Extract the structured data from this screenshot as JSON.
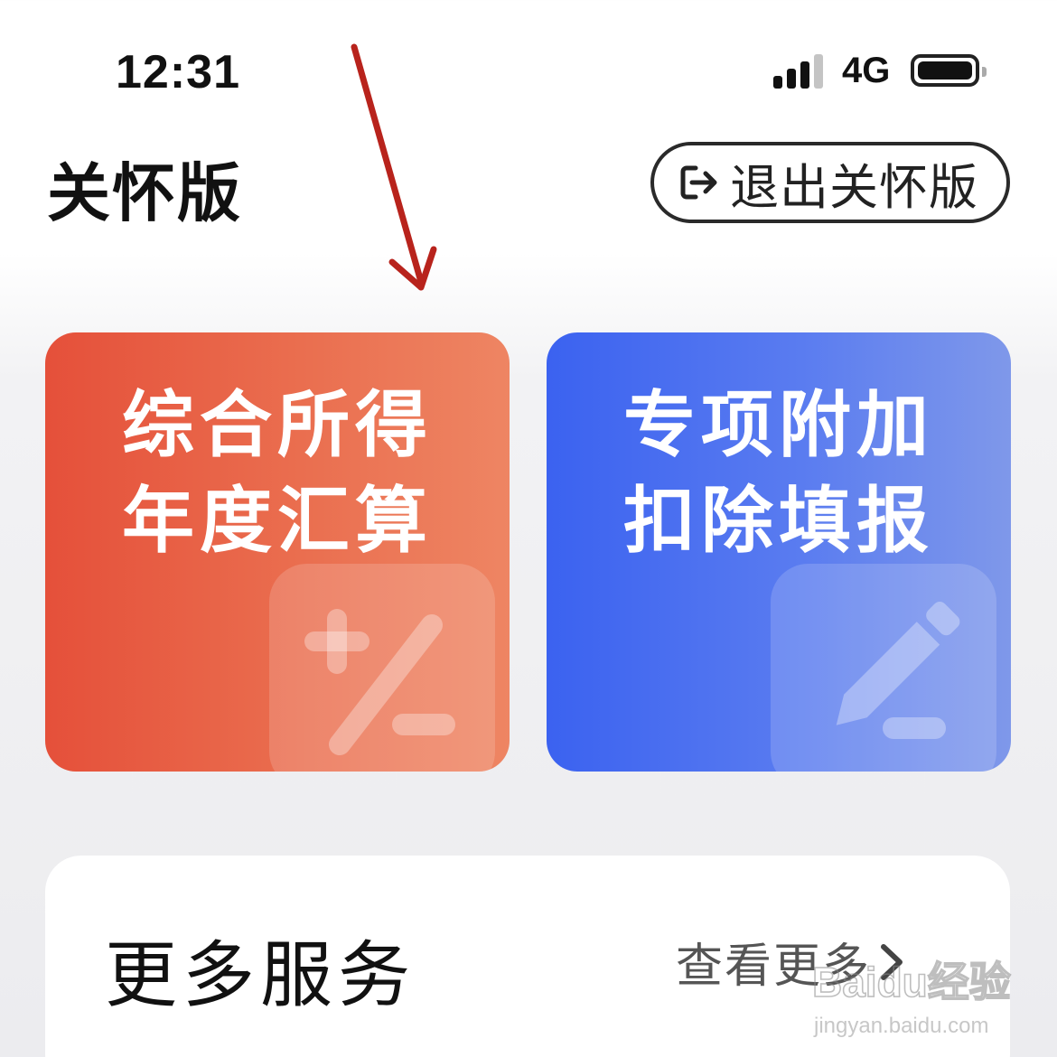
{
  "status_bar": {
    "time": "12:31",
    "network": "4G",
    "signal_bars_active": 3,
    "signal_bars_total": 4
  },
  "header": {
    "title": "关怀版",
    "exit_button_label": "退出关怀版"
  },
  "cards": [
    {
      "line1": "综合所得",
      "line2": "年度汇算",
      "icon": "plus-minus-icon",
      "color": "#e5503a"
    },
    {
      "line1": "专项附加",
      "line2": "扣除填报",
      "icon": "pencil-icon",
      "color": "#3b62f0"
    }
  ],
  "more_services": {
    "title": "更多服务",
    "view_more_label": "查看更多"
  },
  "watermark": {
    "brand": "Baidu经验",
    "url": "jingyan.baidu.com"
  },
  "colors": {
    "annotation_arrow": "#b8231c",
    "red_card": "#e5503a",
    "blue_card": "#3b62f0"
  }
}
